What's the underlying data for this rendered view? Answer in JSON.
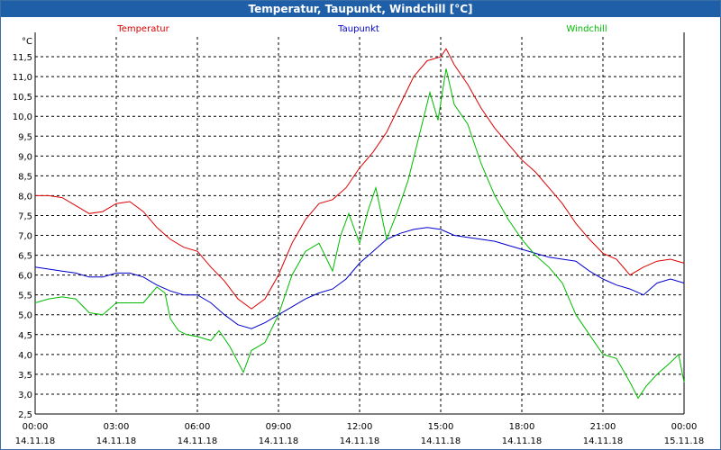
{
  "window": {
    "title": "Temperatur, Taupunkt, Windchill [°C]"
  },
  "chart_data": {
    "type": "line",
    "title": "Temperatur, Taupunkt, Windchill [°C]",
    "ylabel": "°C",
    "xlabel": "",
    "ylim": [
      2.5,
      12.0
    ],
    "grid": true,
    "x_range": [
      "14.11.18 00:00",
      "15.11.18 00:00"
    ],
    "y_ticks": [
      "2,5",
      "3,0",
      "3,5",
      "4,0",
      "4,5",
      "5,0",
      "5,5",
      "6,0",
      "6,5",
      "7,0",
      "7,5",
      "8,0",
      "8,5",
      "9,0",
      "9,5",
      "10,0",
      "10,5",
      "11,0",
      "11,5"
    ],
    "y_tick_values": [
      2.5,
      3.0,
      3.5,
      4.0,
      4.5,
      5.0,
      5.5,
      6.0,
      6.5,
      7.0,
      7.5,
      8.0,
      8.5,
      9.0,
      9.5,
      10.0,
      10.5,
      11.0,
      11.5
    ],
    "x_ticks": [
      {
        "time": "00:00",
        "date": "14.11.18",
        "hour": 0
      },
      {
        "time": "03:00",
        "date": "14.11.18",
        "hour": 3
      },
      {
        "time": "06:00",
        "date": "14.11.18",
        "hour": 6
      },
      {
        "time": "09:00",
        "date": "14.11.18",
        "hour": 9
      },
      {
        "time": "12:00",
        "date": "14.11.18",
        "hour": 12
      },
      {
        "time": "15:00",
        "date": "14.11.18",
        "hour": 15
      },
      {
        "time": "18:00",
        "date": "14.11.18",
        "hour": 18
      },
      {
        "time": "21:00",
        "date": "14.11.18",
        "hour": 21
      },
      {
        "time": "00:00",
        "date": "15.11.18",
        "hour": 24
      }
    ],
    "series": [
      {
        "name": "Temperatur",
        "color": "#dd0000",
        "x": [
          0,
          0.5,
          1,
          1.5,
          2,
          2.5,
          3,
          3.5,
          4,
          4.5,
          5,
          5.5,
          6,
          6.5,
          7,
          7.5,
          8,
          8.5,
          9,
          9.5,
          10,
          10.5,
          11,
          11.5,
          12,
          12.5,
          13,
          13.5,
          14,
          14.5,
          15,
          15.2,
          15.5,
          16,
          16.5,
          17,
          17.5,
          18,
          18.5,
          19,
          19.5,
          20,
          20.5,
          21,
          21.5,
          22,
          22.5,
          23,
          23.5,
          24
        ],
        "values": [
          8.0,
          8.0,
          7.95,
          7.75,
          7.55,
          7.6,
          7.8,
          7.85,
          7.6,
          7.2,
          6.9,
          6.7,
          6.6,
          6.2,
          5.85,
          5.4,
          5.15,
          5.4,
          6.0,
          6.8,
          7.4,
          7.8,
          7.9,
          8.2,
          8.7,
          9.1,
          9.6,
          10.3,
          11.0,
          11.4,
          11.5,
          11.7,
          11.3,
          10.8,
          10.2,
          9.7,
          9.3,
          8.9,
          8.6,
          8.2,
          7.8,
          7.3,
          6.9,
          6.55,
          6.4,
          6.0,
          6.2,
          6.35,
          6.4,
          6.3
        ]
      },
      {
        "name": "Taupunkt",
        "color": "#0000cc",
        "x": [
          0,
          0.5,
          1,
          1.5,
          2,
          2.5,
          3,
          3.5,
          4,
          4.5,
          5,
          5.5,
          6,
          6.5,
          7,
          7.5,
          8,
          8.5,
          9,
          9.5,
          10,
          10.5,
          11,
          11.5,
          12,
          12.5,
          13,
          13.5,
          14,
          14.5,
          15,
          15.5,
          16,
          16.5,
          17,
          17.5,
          18,
          18.5,
          19,
          19.5,
          20,
          20.5,
          21,
          21.5,
          22,
          22.5,
          23,
          23.5,
          24
        ],
        "values": [
          6.2,
          6.15,
          6.1,
          6.05,
          5.95,
          5.95,
          6.05,
          6.05,
          5.95,
          5.75,
          5.6,
          5.5,
          5.5,
          5.3,
          5.0,
          4.75,
          4.65,
          4.8,
          5.0,
          5.2,
          5.4,
          5.55,
          5.65,
          5.9,
          6.3,
          6.6,
          6.9,
          7.05,
          7.15,
          7.2,
          7.15,
          7.0,
          6.95,
          6.9,
          6.85,
          6.75,
          6.65,
          6.55,
          6.45,
          6.4,
          6.35,
          6.1,
          5.9,
          5.75,
          5.65,
          5.5,
          5.8,
          5.9,
          5.8
        ]
      },
      {
        "name": "Windchill",
        "color": "#00bb00",
        "x": [
          0,
          0.5,
          1,
          1.5,
          2,
          2.5,
          3,
          3.5,
          4,
          4.5,
          4.8,
          5,
          5.3,
          5.6,
          6,
          6.5,
          6.8,
          7.2,
          7.7,
          8,
          8.5,
          9,
          9.5,
          10,
          10.5,
          11,
          11.3,
          11.6,
          12,
          12.3,
          12.6,
          13,
          13.4,
          13.8,
          14.2,
          14.6,
          14.9,
          15.2,
          15.5,
          16,
          16.5,
          17,
          17.5,
          18,
          18.5,
          19,
          19.5,
          20,
          20.5,
          21,
          21.5,
          22,
          22.3,
          22.6,
          23,
          23.5,
          23.8,
          24
        ],
        "values": [
          5.3,
          5.4,
          5.45,
          5.4,
          5.05,
          5.0,
          5.3,
          5.3,
          5.3,
          5.7,
          5.55,
          4.9,
          4.6,
          4.5,
          4.45,
          4.35,
          4.6,
          4.2,
          3.55,
          4.1,
          4.3,
          5.0,
          6.0,
          6.6,
          6.8,
          6.1,
          7.0,
          7.55,
          6.8,
          7.6,
          8.2,
          6.9,
          7.6,
          8.4,
          9.5,
          10.6,
          9.9,
          11.2,
          10.3,
          9.8,
          8.8,
          8.0,
          7.4,
          6.9,
          6.5,
          6.2,
          5.8,
          5.0,
          4.5,
          4.0,
          3.9,
          3.3,
          2.9,
          3.2,
          3.5,
          3.8,
          4.0,
          3.3
        ]
      }
    ]
  }
}
